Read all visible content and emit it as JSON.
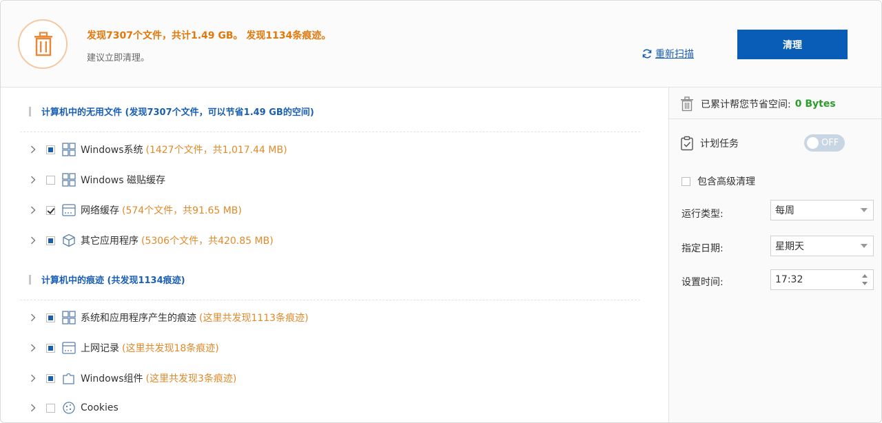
{
  "header": {
    "summary": "发现7307个文件，共计1.49 GB。 发现1134条痕迹。",
    "advice": "建议立即清理。",
    "rescan_label": "重新扫描",
    "clean_label": "清理"
  },
  "sections": [
    {
      "title": "计算机中的无用文件 (发现7307个文件，可以节省1.49 GB的空间)",
      "items": [
        {
          "name": "Windows系统",
          "detail": "(1427个文件，共1,017.44 MB)",
          "check": "partial",
          "icon": "windows-icon"
        },
        {
          "name": "Windows 磁贴缓存",
          "detail": "",
          "check": "unchecked",
          "icon": "windows-icon"
        },
        {
          "name": "网络缓存",
          "detail": "(574个文件，共91.65 MB)",
          "check": "checked",
          "icon": "browser-icon"
        },
        {
          "name": "其它应用程序",
          "detail": "(5306个文件，共420.85 MB)",
          "check": "partial",
          "icon": "box-icon"
        }
      ]
    },
    {
      "title": "计算机中的痕迹 (共发现1134痕迹)",
      "items": [
        {
          "name": "系统和应用程序产生的痕迹",
          "detail": "(这里共发现1113条痕迹)",
          "check": "partial",
          "icon": "windows-icon"
        },
        {
          "name": "上网记录",
          "detail": "(这里共发现18条痕迹)",
          "check": "partial",
          "icon": "browser-icon"
        },
        {
          "name": "Windows组件",
          "detail": "(这里共发现3条痕迹)",
          "check": "partial",
          "icon": "puzzle-icon"
        },
        {
          "name": "Cookies",
          "detail": "",
          "check": "unchecked",
          "icon": "cookie-icon"
        }
      ]
    }
  ],
  "panel": {
    "saved_label": "已累计帮您节省空间:",
    "saved_value": "0 Bytes",
    "task_label": "计划任务",
    "toggle_state": "OFF",
    "advanced_label": "包含高级清理",
    "run_type_label": "运行类型:",
    "run_type_value": "每周",
    "date_label": "指定日期:",
    "date_value": "星期天",
    "time_label": "设置时间:",
    "time_value": "17:32"
  },
  "colors": {
    "accent": "#0a5db6",
    "warning": "#e0780c",
    "detail": "#e08a2a",
    "link": "#1a5fb4",
    "saved": "#2a9d2a"
  }
}
